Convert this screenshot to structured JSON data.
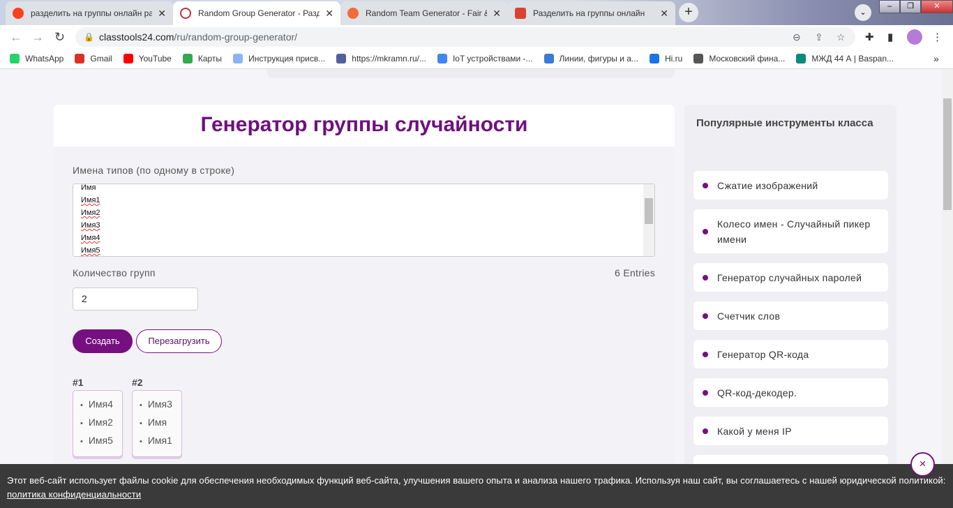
{
  "browser": {
    "tabs": [
      {
        "title": "разделить на группы онлайн ра",
        "icon": "yandex-icon",
        "color": "#fc3f1d",
        "active": false
      },
      {
        "title": "Random Group Generator - Разд",
        "icon": "classtools-icon",
        "color": "#c0303a",
        "active": true
      },
      {
        "title": "Random Team Generator - Fair &",
        "icon": "shuffle-icon",
        "color": "#f26b3a",
        "active": false
      },
      {
        "title": "Разделить на группы онлайн",
        "icon": "dice-icon",
        "color": "#d9432e",
        "active": false
      }
    ],
    "url_domain": "classtools24.com",
    "url_path": "/ru/random-group-generator/",
    "bookmarks": [
      {
        "label": "WhatsApp",
        "icon": "whatsapp-icon",
        "color": "#25d366"
      },
      {
        "label": "Gmail",
        "icon": "gmail-icon",
        "color": "#d93025"
      },
      {
        "label": "YouTube",
        "icon": "youtube-icon",
        "color": "#ff0000"
      },
      {
        "label": "Карты",
        "icon": "maps-icon",
        "color": "#34a853"
      },
      {
        "label": "Инструкция присв...",
        "icon": "grid-icon",
        "color": "#8ab4f8"
      },
      {
        "label": "https://mkramn.ru/...",
        "icon": "site-icon",
        "color": "#5060a0"
      },
      {
        "label": "IoT устройствами -...",
        "icon": "google-icon",
        "color": "#4285f4"
      },
      {
        "label": "Линии, фигуры и а...",
        "icon": "balloon-icon",
        "color": "#3a7bd5"
      },
      {
        "label": "Hi.ru",
        "icon": "hi-icon",
        "color": "#1a73e8"
      },
      {
        "label": "Московский фина...",
        "icon": "globe-icon",
        "color": "#555555"
      },
      {
        "label": "МЖД 44 А | Baspan...",
        "icon": "baspan-icon",
        "color": "#0a8a7a"
      }
    ],
    "more_bookmarks": "»"
  },
  "page": {
    "title": "Генератор группы случайности",
    "names_label": "Имена типов (по одному в строке)",
    "names": [
      "Имя",
      "Имя1",
      "Имя2",
      "Имя3",
      "Имя4",
      "Имя5"
    ],
    "groups_label": "Количество групп",
    "entries": "6 Entries",
    "groups_count": "2",
    "create_button": "Создать",
    "reload_button": "Перезагрузить",
    "groups": [
      {
        "title": "#1",
        "members": [
          "Имя4",
          "Имя2",
          "Имя5"
        ]
      },
      {
        "title": "#2",
        "members": [
          "Имя3",
          "Имя",
          "Имя1"
        ]
      }
    ]
  },
  "sidebar": {
    "title": "Популярные инструменты класса",
    "items": [
      "Сжатие изображений",
      "Колесо имен - Случайный пикер имени",
      "Генератор случайных паролей",
      "Счетчик слов",
      "Генератор QR-кода",
      "QR-код-декодер.",
      "Какой у меня IP"
    ]
  },
  "cookie": {
    "text": "Этот веб-сайт использует файлы cookie для обеспечения необходимых функций веб-сайта, улучшения вашего опыта и анализа нашего трафика. Используя наш сайт, вы соглашаетесь с нашей юридической политикой: ",
    "link": "политика конфиденциальности",
    "close": "×"
  },
  "accent": "#760f80"
}
